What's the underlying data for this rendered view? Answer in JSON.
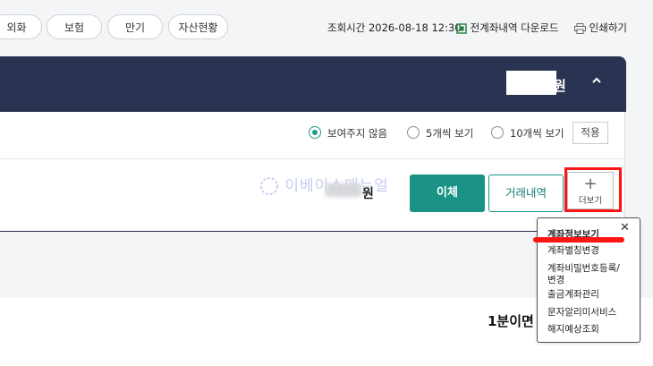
{
  "tabs": [
    "외화",
    "보험",
    "만기",
    "자산현황"
  ],
  "query_time": "조회시간 2026-08-18 12:30",
  "download_label": "전계좌내역 다운로드",
  "print_label": "인쇄하기",
  "account": {
    "total_suffix": "원",
    "balance_suffix": "원"
  },
  "view_options": {
    "options": [
      "보여주지 않음",
      "5개씩 보기",
      "10개씩 보기"
    ],
    "selected_index": 0,
    "apply_label": "적용"
  },
  "watermark": "이베이스매뉴얼",
  "actions": {
    "transfer": "이체",
    "history": "거래내역",
    "more_label": "더보기"
  },
  "dropdown_items": [
    "계좌정보보기",
    "계좌별칭변경",
    "계좌비밀번호등록/\n변경",
    "출금계좌관리",
    "문자알리미서비스",
    "해지예상조회"
  ],
  "bottom_text": "1분이면",
  "colors": {
    "header_bg": "#2b3352",
    "accent": "#1a9386",
    "highlight": "#ff1414"
  }
}
